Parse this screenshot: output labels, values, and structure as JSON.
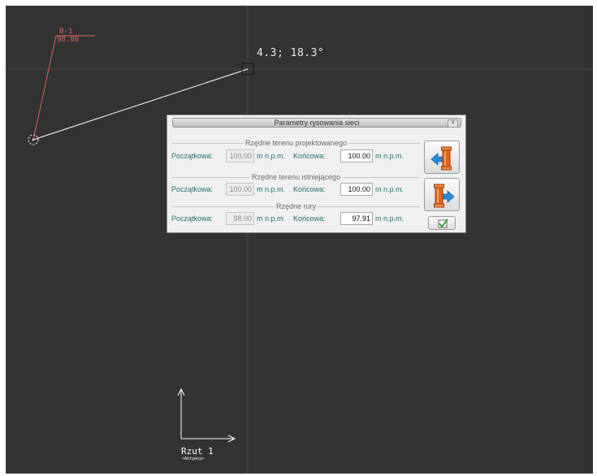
{
  "drawing": {
    "node": {
      "code": "B-1",
      "elevation": "98.00",
      "color": "#e06060"
    },
    "cursor_readout": "4.3; 18.3°",
    "view": {
      "name": "Rzut 1",
      "status": "<Aktywny>"
    },
    "background": "#333333"
  },
  "dialog": {
    "title": "Parametry rysowania sieci",
    "close_icon": "close-icon",
    "sections": {
      "terrain_designed": {
        "title": "Rzędne terenu projektowanego",
        "start_label": "Początkowa:",
        "start_value": "100.00",
        "start_unit": "m n.p.m.",
        "end_label": "Końcowa:",
        "end_value": "100.00",
        "end_unit": "m n.p.m."
      },
      "terrain_existing": {
        "title": "Rzędne terenu istniejącego",
        "start_label": "Początkowa:",
        "start_value": "100.00",
        "start_unit": "m n.p.m.",
        "end_label": "Końcowa:",
        "end_value": "100.00",
        "end_unit": "m n.p.m."
      },
      "pipe": {
        "title": "Rzędne rury",
        "start_label": "Początkowa:",
        "start_value": "98.00",
        "start_unit": "m n.p.m.",
        "end_label": "Końcowa:",
        "end_value": "97.91",
        "end_unit": "m n.p.m."
      }
    },
    "buttons": {
      "previous_icon": "pipe-arrow-left-icon",
      "next_icon": "pipe-arrow-right-icon",
      "ok_icon": "checkbox-check-icon"
    },
    "colors": {
      "label_text": "#1e6e6e",
      "arrow_blue": "#2f8ad6",
      "pipe_orange": "#e0681d"
    }
  }
}
